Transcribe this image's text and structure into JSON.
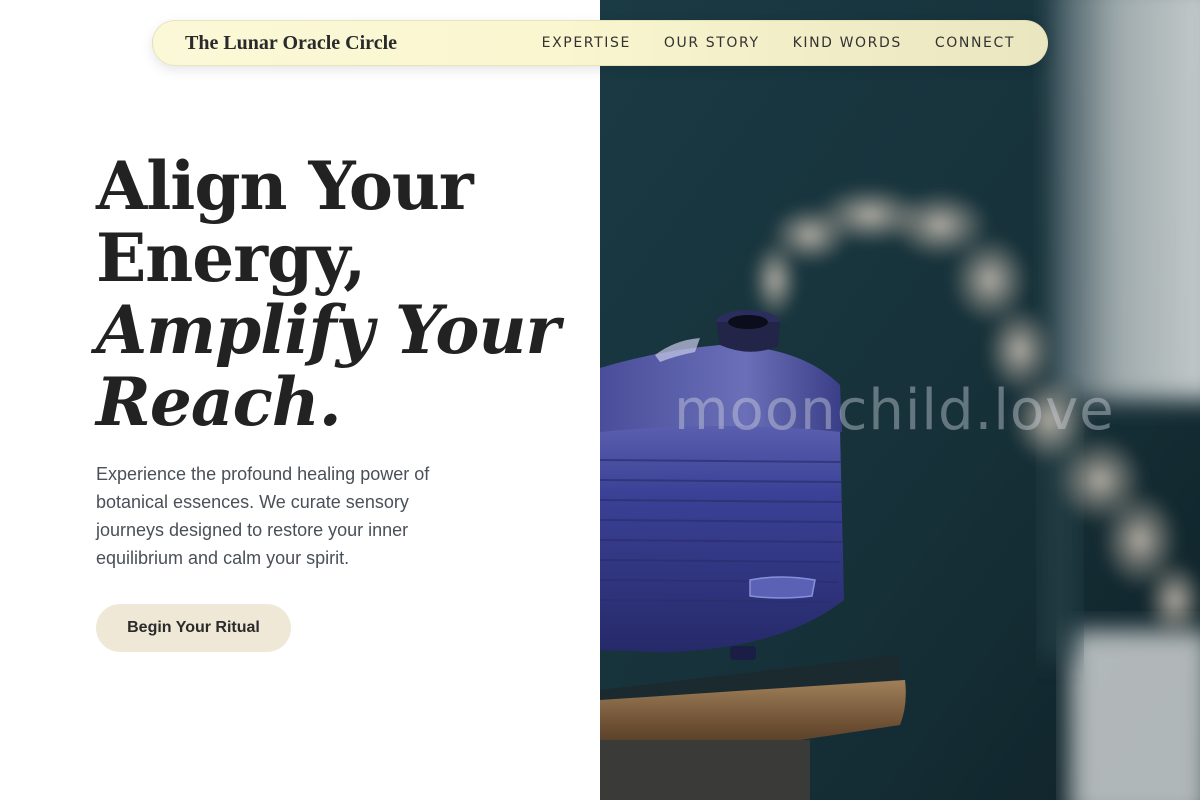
{
  "nav": {
    "brand": "The Lunar Oracle Circle",
    "links": [
      "EXPERTISE",
      "OUR STORY",
      "KIND WORDS",
      "CONNECT"
    ]
  },
  "hero": {
    "headline_lines": [
      "Align Your",
      "Energy,"
    ],
    "headline_italic_lines": [
      "Amplify Your",
      "Reach."
    ],
    "intro": "Experience the profound healing power of botanical essences. We curate sensory journeys designed to restore your inner equilibrium and calm your spirit.",
    "cta_label": "Begin Your Ritual"
  },
  "image": {
    "subject": "blue aroma diffuser releasing steam on a wooden table",
    "watermark": "moonchild.love"
  },
  "colors": {
    "nav_bg": "#faf6cf",
    "cta_bg": "#efe8d6",
    "text_dark": "#222222",
    "text_body": "#4a5058",
    "image_bg": "#1c3a42",
    "diffuser_blue": "#3a3f8c"
  }
}
